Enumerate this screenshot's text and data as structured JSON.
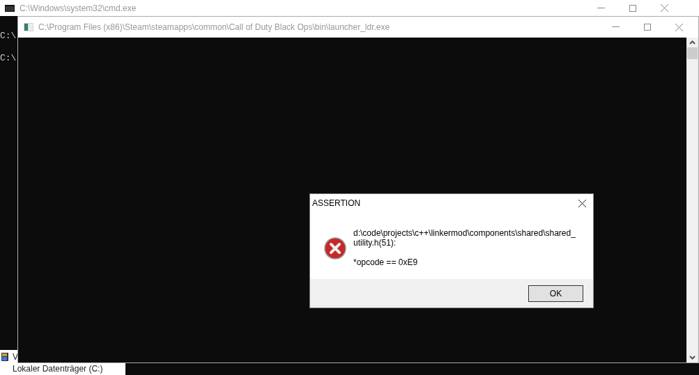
{
  "back_window": {
    "title": "C:\\Windows\\system32\\cmd.exe",
    "console_lines": [
      "C:\\",
      "C:\\"
    ]
  },
  "partial_window": {
    "items": [
      "V",
      "Lokaler Datenträger (C:)"
    ]
  },
  "main_window": {
    "title": "C:\\Program Files (x86)\\Steam\\steamapps\\common\\Call of Duty Black Ops\\bin\\launcher_ldr.exe"
  },
  "dialog": {
    "title": "ASSERTION",
    "message_lines": [
      "d:\\code\\projects\\c++\\linkermod\\components\\shared\\shared_",
      "utility.h(51):"
    ],
    "expression": "*opcode == 0xE9",
    "buttons": [
      "OK"
    ]
  }
}
